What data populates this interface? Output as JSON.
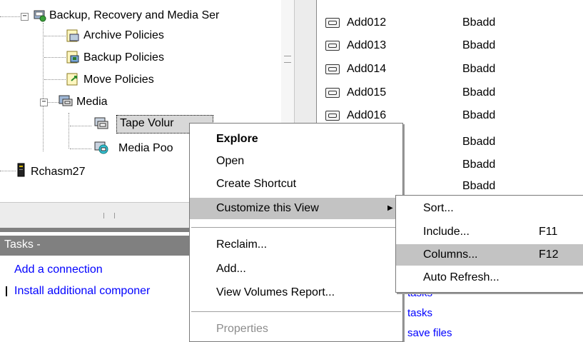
{
  "tree": {
    "root": "Backup, Recovery and Media Ser",
    "archive": "Archive Policies",
    "backup": "Backup Policies",
    "move": "Move Policies",
    "media": "Media",
    "tape": "Tape Volur",
    "pool": "Media Poo",
    "system": "Rchasm27"
  },
  "list": {
    "rows": [
      {
        "name": "Add012",
        "owner": "Bbadd"
      },
      {
        "name": "Add013",
        "owner": "Bbadd"
      },
      {
        "name": "Add014",
        "owner": "Bbadd"
      },
      {
        "name": "Add015",
        "owner": "Bbadd"
      },
      {
        "name": "Add016",
        "owner": "Bbadd"
      }
    ],
    "owners_below": [
      "Bbadd",
      "Bbadd",
      "Bbadd"
    ],
    "bottom_links": [
      "tasks",
      "tasks",
      "save files"
    ]
  },
  "tasks": {
    "header": "Tasks -",
    "links": [
      "Add a connection",
      "Install additional componer"
    ]
  },
  "context_menu": {
    "explore": "Explore",
    "open": "Open",
    "shortcut": "Create Shortcut",
    "customize": "Customize this View",
    "reclaim": "Reclaim...",
    "add": "Add...",
    "report": "View Volumes Report...",
    "properties": "Properties"
  },
  "submenu": {
    "sort": "Sort...",
    "include": "Include...",
    "include_key": "F11",
    "columns": "Columns...",
    "columns_key": "F12",
    "refresh": "Auto Refresh..."
  },
  "colors": {
    "highlight": "#c3c3c3",
    "tasks_header": "#808080",
    "link": "#0000ff"
  }
}
